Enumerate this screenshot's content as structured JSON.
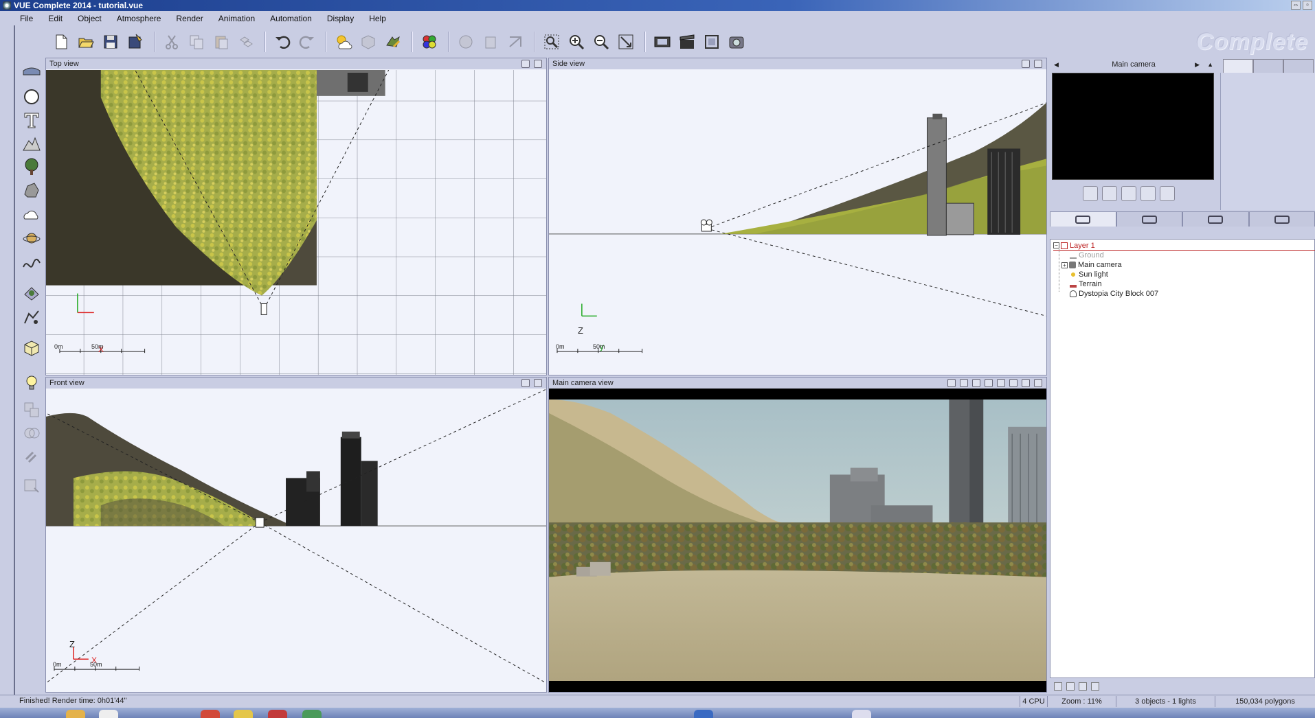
{
  "window": {
    "title": "VUE Complete 2014 - tutorial.vue",
    "brand_watermark": "Complete"
  },
  "menu": [
    "File",
    "Edit",
    "Object",
    "Atmosphere",
    "Render",
    "Animation",
    "Automation",
    "Display",
    "Help"
  ],
  "toolbar": {
    "icons": [
      "new-icon",
      "open-icon",
      "save-icon",
      "save-as-icon",
      "cut-icon",
      "copy-icon",
      "paste-icon",
      "duplicate-icon",
      "undo-icon",
      "redo-icon",
      "atmosphere-editor-icon",
      "material-icon",
      "function-icon",
      "color-palette-icon",
      "render-icon",
      "zoom-to-fit-icon",
      "zoom-in-icon",
      "zoom-out-icon",
      "zoom-region-icon",
      "render-preview-icon",
      "animation-icon",
      "render-area-icon",
      "render-settings-icon"
    ]
  },
  "left_tools": {
    "icons": [
      "infinite-plane-icon",
      "sphere-icon",
      "text-icon",
      "terrain-icon",
      "tree-icon",
      "rock-icon",
      "cloud-icon",
      "planet-icon",
      "path-icon",
      "ecosystem-icon",
      "scatter-icon",
      "object-import-icon",
      "light-icon",
      "group-icon",
      "boolean-icon",
      "link-icon",
      "metablob-icon"
    ]
  },
  "viewports": {
    "top": {
      "title": "Top view",
      "axis_x": "X",
      "scale_start": "0m",
      "scale_end": "50m"
    },
    "side": {
      "title": "Side view",
      "axis_z": "Z",
      "axis_y": "y",
      "scale_start": "0m",
      "scale_end": "50m"
    },
    "front": {
      "title": "Front view",
      "axis_z": "Z",
      "axis_x": "X",
      "scale_start": "0m",
      "scale_end": "50m"
    },
    "camera": {
      "title": "Main camera view"
    }
  },
  "camera_panel": {
    "title": "Main camera"
  },
  "world_tabs": [
    "objects-tab",
    "materials-tab",
    "library-tab",
    "links-tab"
  ],
  "layers": {
    "layer_name": "Layer 1",
    "objects": [
      "Ground",
      "Main camera",
      "Sun light",
      "Terrain",
      "Dystopia City Block 007"
    ]
  },
  "status": {
    "message": "Finished! Render time: 0h01'44\"",
    "cpu": "4 CPU",
    "zoom": "Zoom : 11%",
    "objects": "3 objects - 1 lights",
    "polygons": "150,034 polygons"
  },
  "colors": {
    "ui_bg": "#c9cde3",
    "viewport_bg": "#f1f3fb",
    "layer_text": "#b22222",
    "title_bar": "#1d3f8e"
  }
}
